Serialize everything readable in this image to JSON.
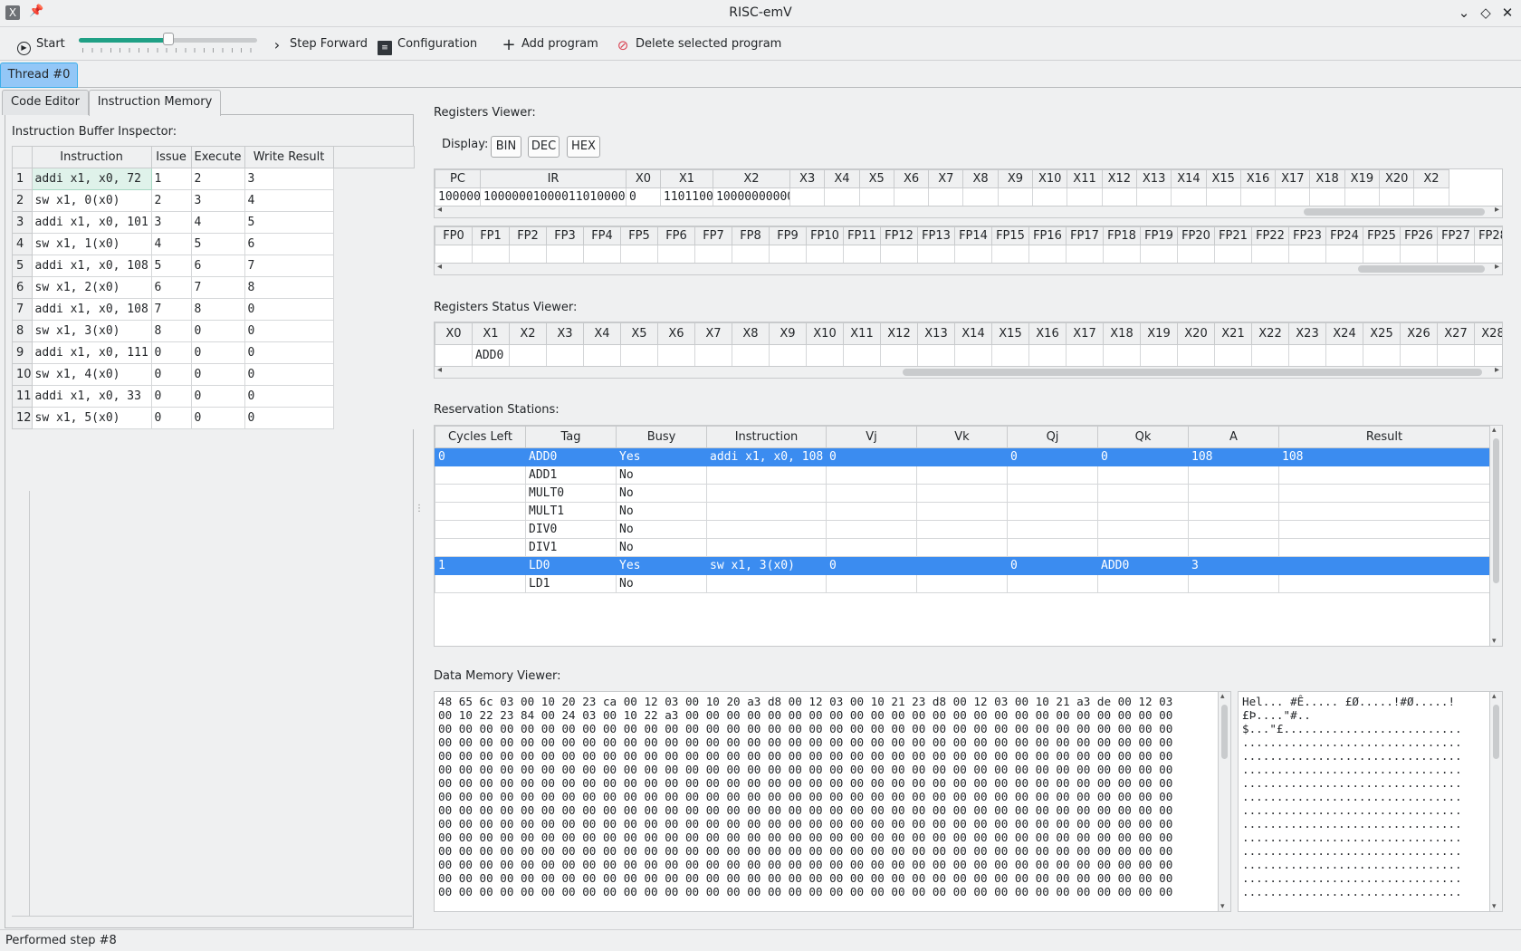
{
  "window": {
    "title": "RISC-emV",
    "app_icon": "x-icon",
    "pin_icon": "pin-icon"
  },
  "toolbar": {
    "start_label": "Start",
    "step_speed": 0.5,
    "step_forward_label": "Step Forward",
    "configuration_label": "Configuration",
    "add_program_label": "Add program",
    "delete_program_label": "Delete selected program",
    "accent_color": "#1fa085"
  },
  "thread_tab": "Thread #0",
  "tabs": {
    "code_editor": "Code Editor",
    "instruction_memory": "Instruction Memory"
  },
  "instruction_buffer": {
    "label": "Instruction Buffer Inspector:",
    "columns": [
      "Instruction",
      "Issue",
      "Execute",
      "Write Result"
    ],
    "rows": [
      [
        "1",
        "addi x1, x0, 72",
        "1",
        "2",
        "3"
      ],
      [
        "2",
        "sw x1, 0(x0)",
        "2",
        "3",
        "4"
      ],
      [
        "3",
        "addi x1, x0, 101",
        "3",
        "4",
        "5"
      ],
      [
        "4",
        "sw x1, 1(x0)",
        "4",
        "5",
        "6"
      ],
      [
        "5",
        "addi x1, x0, 108",
        "5",
        "6",
        "7"
      ],
      [
        "6",
        "sw x1, 2(x0)",
        "6",
        "7",
        "8"
      ],
      [
        "7",
        "addi x1, x0, 108",
        "7",
        "8",
        "0"
      ],
      [
        "8",
        "sw x1, 3(x0)",
        "8",
        "0",
        "0"
      ],
      [
        "9",
        "addi x1, x0, 111",
        "0",
        "0",
        "0"
      ],
      [
        "10",
        "sw x1, 4(x0)",
        "0",
        "0",
        "0"
      ],
      [
        "11",
        "addi x1, x0, 33",
        "0",
        "0",
        "0"
      ],
      [
        "12",
        "sw x1, 5(x0)",
        "0",
        "0",
        "0"
      ]
    ]
  },
  "registers_viewer": {
    "label": "Registers Viewer:",
    "display_label": "Display:",
    "display_buttons": [
      "BIN",
      "DEC",
      "HEX"
    ],
    "int_columns": [
      "PC",
      "IR",
      "X0",
      "X1",
      "X2",
      "X3",
      "X4",
      "X5",
      "X6",
      "X7",
      "X8",
      "X9",
      "X10",
      "X11",
      "X12",
      "X13",
      "X14",
      "X15",
      "X16",
      "X17",
      "X18",
      "X19",
      "X20",
      "X2"
    ],
    "int_values": [
      "100000",
      "1000000100001101000011",
      "0",
      "1101100",
      "10000000000",
      "",
      "",
      "",
      "",
      "",
      "",
      "",
      "",
      "",
      "",
      "",
      "",
      "",
      "",
      "",
      "",
      "",
      "",
      ""
    ],
    "fp_columns": [
      "FP0",
      "FP1",
      "FP2",
      "FP3",
      "FP4",
      "FP5",
      "FP6",
      "FP7",
      "FP8",
      "FP9",
      "FP10",
      "FP11",
      "FP12",
      "FP13",
      "FP14",
      "FP15",
      "FP16",
      "FP17",
      "FP18",
      "FP19",
      "FP20",
      "FP21",
      "FP22",
      "FP23",
      "FP24",
      "FP25",
      "FP26",
      "FP27",
      "FP28"
    ]
  },
  "registers_status": {
    "label": "Registers Status Viewer:",
    "columns": [
      "X0",
      "X1",
      "X2",
      "X3",
      "X4",
      "X5",
      "X6",
      "X7",
      "X8",
      "X9",
      "X10",
      "X11",
      "X12",
      "X13",
      "X14",
      "X15",
      "X16",
      "X17",
      "X18",
      "X19",
      "X20",
      "X21",
      "X22",
      "X23",
      "X24",
      "X25",
      "X26",
      "X27",
      "X28"
    ],
    "values": [
      "",
      "ADD0",
      "",
      "",
      "",
      "",
      "",
      "",
      "",
      "",
      "",
      "",
      "",
      "",
      "",
      "",
      "",
      "",
      "",
      "",
      "",
      "",
      "",
      "",
      "",
      "",
      "",
      "",
      ""
    ]
  },
  "reservation_stations": {
    "label": "Reservation Stations:",
    "columns": [
      "Cycles Left",
      "Tag",
      "Busy",
      "Instruction",
      "Vj",
      "Vk",
      "Qj",
      "Qk",
      "A",
      "Result"
    ],
    "rows": [
      {
        "cells": [
          "0",
          "ADD0",
          "Yes",
          "addi x1, x0, 108",
          "0",
          "",
          "0",
          "0",
          "108",
          "108"
        ],
        "highlight": true
      },
      {
        "cells": [
          "",
          "ADD1",
          "No",
          "",
          "",
          "",
          "",
          "",
          "",
          ""
        ],
        "highlight": false
      },
      {
        "cells": [
          "",
          "MULT0",
          "No",
          "",
          "",
          "",
          "",
          "",
          "",
          ""
        ],
        "highlight": false
      },
      {
        "cells": [
          "",
          "MULT1",
          "No",
          "",
          "",
          "",
          "",
          "",
          "",
          ""
        ],
        "highlight": false
      },
      {
        "cells": [
          "",
          "DIV0",
          "No",
          "",
          "",
          "",
          "",
          "",
          "",
          ""
        ],
        "highlight": false
      },
      {
        "cells": [
          "",
          "DIV1",
          "No",
          "",
          "",
          "",
          "",
          "",
          "",
          ""
        ],
        "highlight": false
      },
      {
        "cells": [
          "1",
          "LD0",
          "Yes",
          "sw x1, 3(x0)",
          "0",
          "",
          "0",
          "ADD0",
          "3",
          ""
        ],
        "highlight": true
      },
      {
        "cells": [
          "",
          "LD1",
          "No",
          "",
          "",
          "",
          "",
          "",
          "",
          ""
        ],
        "highlight": false
      }
    ],
    "highlight_color": "#3b8cf0"
  },
  "data_memory": {
    "label": "Data Memory Viewer:",
    "hex_lines": [
      "48 65 6c 03 00 10 20 23 ca 00 12 03 00 10 20 a3 d8 00 12 03 00 10 21 23 d8 00 12 03 00 10 21 a3 de 00 12 03",
      "00 10 22 23 84 00 24 03 00 10 22 a3 00 00 00 00 00 00 00 00 00 00 00 00 00 00 00 00 00 00 00 00 00 00 00 00",
      "00 00 00 00 00 00 00 00 00 00 00 00 00 00 00 00 00 00 00 00 00 00 00 00 00 00 00 00 00 00 00 00 00 00 00 00",
      "00 00 00 00 00 00 00 00 00 00 00 00 00 00 00 00 00 00 00 00 00 00 00 00 00 00 00 00 00 00 00 00 00 00 00 00",
      "00 00 00 00 00 00 00 00 00 00 00 00 00 00 00 00 00 00 00 00 00 00 00 00 00 00 00 00 00 00 00 00 00 00 00 00",
      "00 00 00 00 00 00 00 00 00 00 00 00 00 00 00 00 00 00 00 00 00 00 00 00 00 00 00 00 00 00 00 00 00 00 00 00",
      "00 00 00 00 00 00 00 00 00 00 00 00 00 00 00 00 00 00 00 00 00 00 00 00 00 00 00 00 00 00 00 00 00 00 00 00",
      "00 00 00 00 00 00 00 00 00 00 00 00 00 00 00 00 00 00 00 00 00 00 00 00 00 00 00 00 00 00 00 00 00 00 00 00",
      "00 00 00 00 00 00 00 00 00 00 00 00 00 00 00 00 00 00 00 00 00 00 00 00 00 00 00 00 00 00 00 00 00 00 00 00",
      "00 00 00 00 00 00 00 00 00 00 00 00 00 00 00 00 00 00 00 00 00 00 00 00 00 00 00 00 00 00 00 00 00 00 00 00",
      "00 00 00 00 00 00 00 00 00 00 00 00 00 00 00 00 00 00 00 00 00 00 00 00 00 00 00 00 00 00 00 00 00 00 00 00",
      "00 00 00 00 00 00 00 00 00 00 00 00 00 00 00 00 00 00 00 00 00 00 00 00 00 00 00 00 00 00 00 00 00 00 00 00",
      "00 00 00 00 00 00 00 00 00 00 00 00 00 00 00 00 00 00 00 00 00 00 00 00 00 00 00 00 00 00 00 00 00 00 00 00",
      "00 00 00 00 00 00 00 00 00 00 00 00 00 00 00 00 00 00 00 00 00 00 00 00 00 00 00 00 00 00 00 00 00 00 00 00",
      "00 00 00 00 00 00 00 00 00 00 00 00 00 00 00 00 00 00 00 00 00 00 00 00 00 00 00 00 00 00 00 00 00 00 00 00"
    ],
    "ascii_lines": [
      "Hel... #Ê..... £Ø.....!#Ø.....!",
      "£Þ....\"#..",
      "$...\"£..........................",
      "................................",
      "................................",
      "................................",
      "................................",
      "................................",
      "................................",
      "................................",
      "................................",
      "................................",
      "................................",
      "................................",
      "................................"
    ]
  },
  "status_bar": "Performed step #8"
}
